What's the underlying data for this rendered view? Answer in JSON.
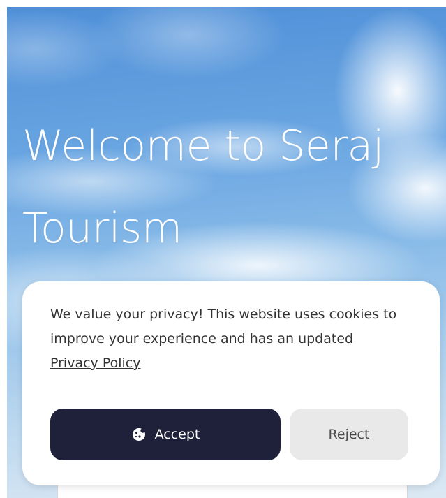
{
  "hero": {
    "title": "Welcome to Seraj Tourism"
  },
  "cookie_banner": {
    "message": "We value your privacy! This website uses cookies to improve your experience and has an updated ",
    "policy_link": "Privacy Policy",
    "accept_label": "Accept",
    "reject_label": "Reject",
    "accept_icon": "cookie-icon"
  },
  "colors": {
    "accept_bg": "#1e2139",
    "reject_bg": "#e9e9e9"
  }
}
